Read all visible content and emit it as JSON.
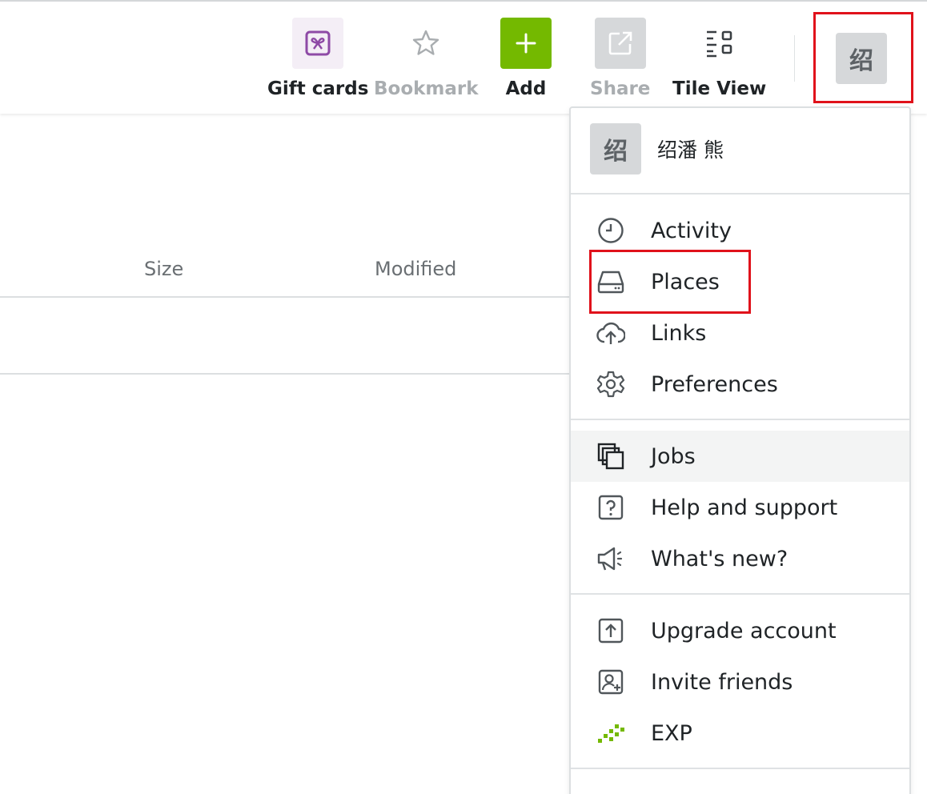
{
  "toolbar": {
    "gift_cards_label": "Gift cards",
    "bookmark_label": "Bookmark",
    "add_label": "Add",
    "share_label": "Share",
    "tile_view_label": "Tile View",
    "avatar_initial": "绍"
  },
  "file_list": {
    "columns": {
      "size": "Size",
      "modified": "Modified"
    }
  },
  "account_menu": {
    "user": {
      "initial": "绍",
      "name": "绍潘 熊"
    },
    "items": [
      {
        "label": "Activity",
        "icon": "clock-icon"
      },
      {
        "label": "Places",
        "icon": "drive-icon"
      },
      {
        "label": "Links",
        "icon": "cloud-upload-icon"
      },
      {
        "label": "Preferences",
        "icon": "gear-icon"
      },
      {
        "label": "Jobs",
        "icon": "stacked-squares-icon"
      },
      {
        "label": "Help and support",
        "icon": "question-icon"
      },
      {
        "label": "What's new?",
        "icon": "megaphone-icon"
      },
      {
        "label": "Upgrade account",
        "icon": "upgrade-icon"
      },
      {
        "label": "Invite friends",
        "icon": "invite-icon"
      },
      {
        "label": "EXP",
        "icon": "exp-icon"
      }
    ]
  },
  "colors": {
    "add_green": "#74b900",
    "gift_purple": "#8e4aa6",
    "highlight_red": "#e0121b"
  }
}
